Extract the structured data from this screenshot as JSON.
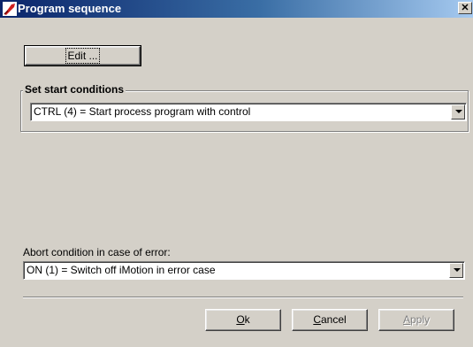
{
  "window": {
    "title": "Program sequence",
    "close_glyph": "✕",
    "app_icon": "app-icon"
  },
  "edit_button": {
    "label": "Edit ..."
  },
  "start_conditions": {
    "legend": "Set start conditions",
    "selected": "CTRL (4) = Start process program with control"
  },
  "abort": {
    "label": "Abort condition in case of error:",
    "selected": "ON (1) = Switch off iMotion in error case"
  },
  "buttons": {
    "ok": {
      "accel": "O",
      "rest": "k"
    },
    "cancel": {
      "accel": "C",
      "rest": "ancel"
    },
    "apply": {
      "accel": "A",
      "rest": "pply"
    }
  }
}
